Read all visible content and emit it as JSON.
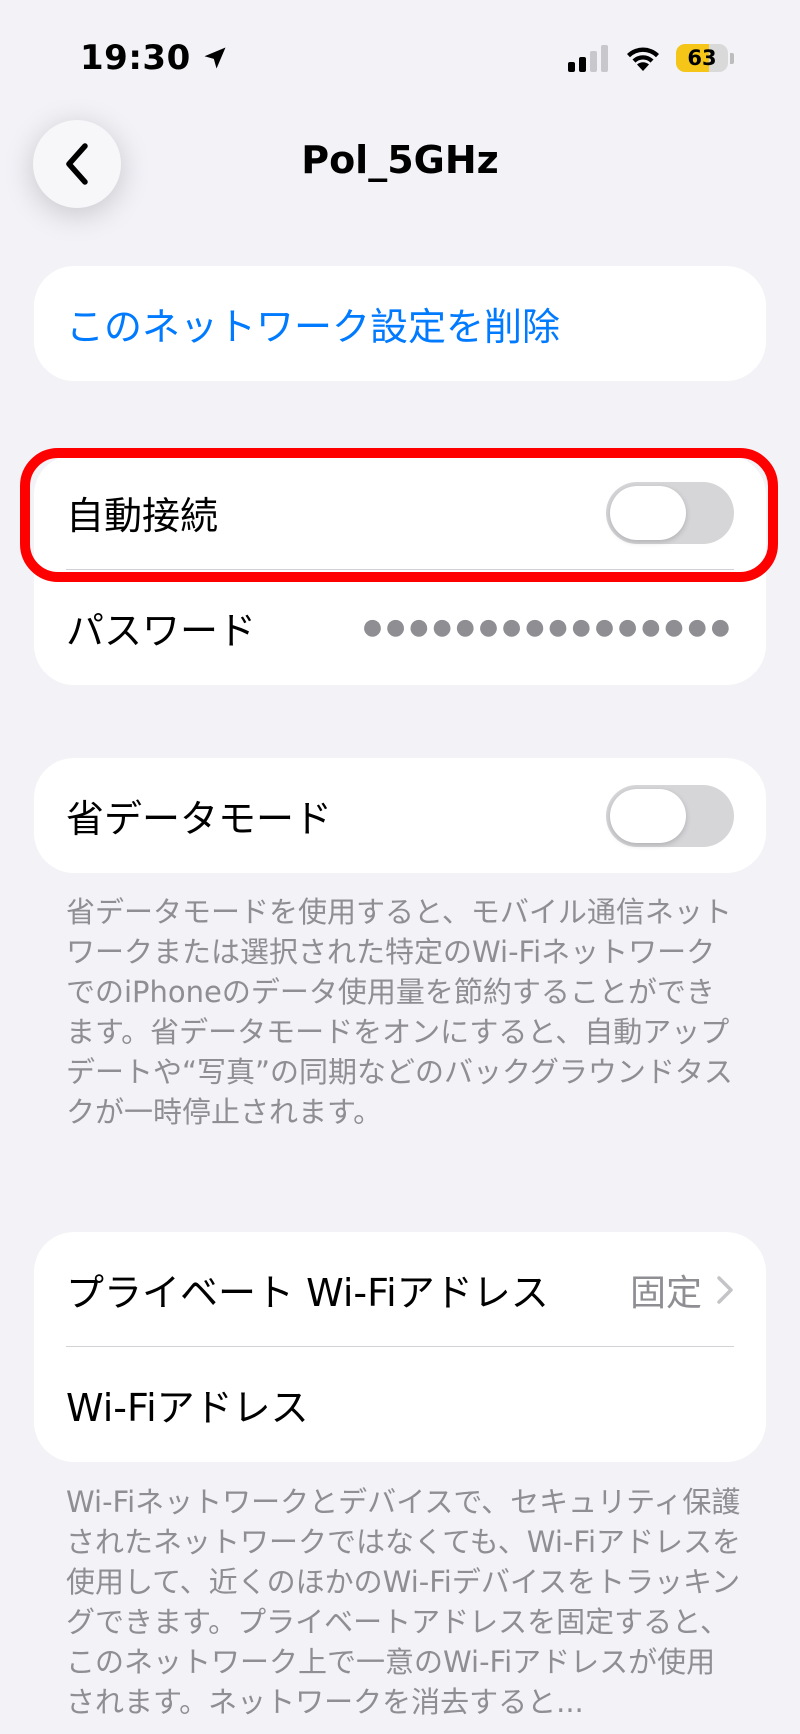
{
  "status_bar": {
    "time": "19:30",
    "battery": "63",
    "battery_level": 0.63,
    "icons": [
      "location-arrow-icon",
      "cellular-signal-icon",
      "wifi-icon",
      "battery-icon"
    ]
  },
  "nav": {
    "title": "Pol_5GHz",
    "back_icon": "chevron-left-icon"
  },
  "forget": {
    "label": "このネットワーク設定を削除"
  },
  "network": {
    "auto_join_label": "自動接続",
    "auto_join_on": false,
    "password_label": "パスワード",
    "password_value": "●●●●●●●●●●●●●●●●"
  },
  "low_data": {
    "label": "省データモード",
    "on": false,
    "description": "省データモードを使用すると、モバイル通信ネットワークまたは選択された特定のWi-FiネットワークでのiPhoneのデータ使用量を節約することができます。省データモードをオンにすると、自動アップデートや“写真”の同期などのバックグラウンドタスクが一時停止されます。"
  },
  "private_address": {
    "label": "プライベート Wi-Fiアドレス",
    "value": "固定",
    "wifi_address_label": "Wi-Fiアドレス",
    "description": "Wi-Fiネットワークとデバイスで、セキュリティ保護されたネットワークではなくても、Wi-Fiアドレスを使用して、近くのほかのWi-Fiデバイスをトラッキングできます。プライベートアドレスを固定すると、このネットワーク上で一意のWi-Fiアドレスが使用されます。ネットワークを消去すると..."
  },
  "colors": {
    "accent": "#007aff",
    "highlight": "#ff0000",
    "battery": "#f5c518",
    "background": "#f2f2f7"
  }
}
